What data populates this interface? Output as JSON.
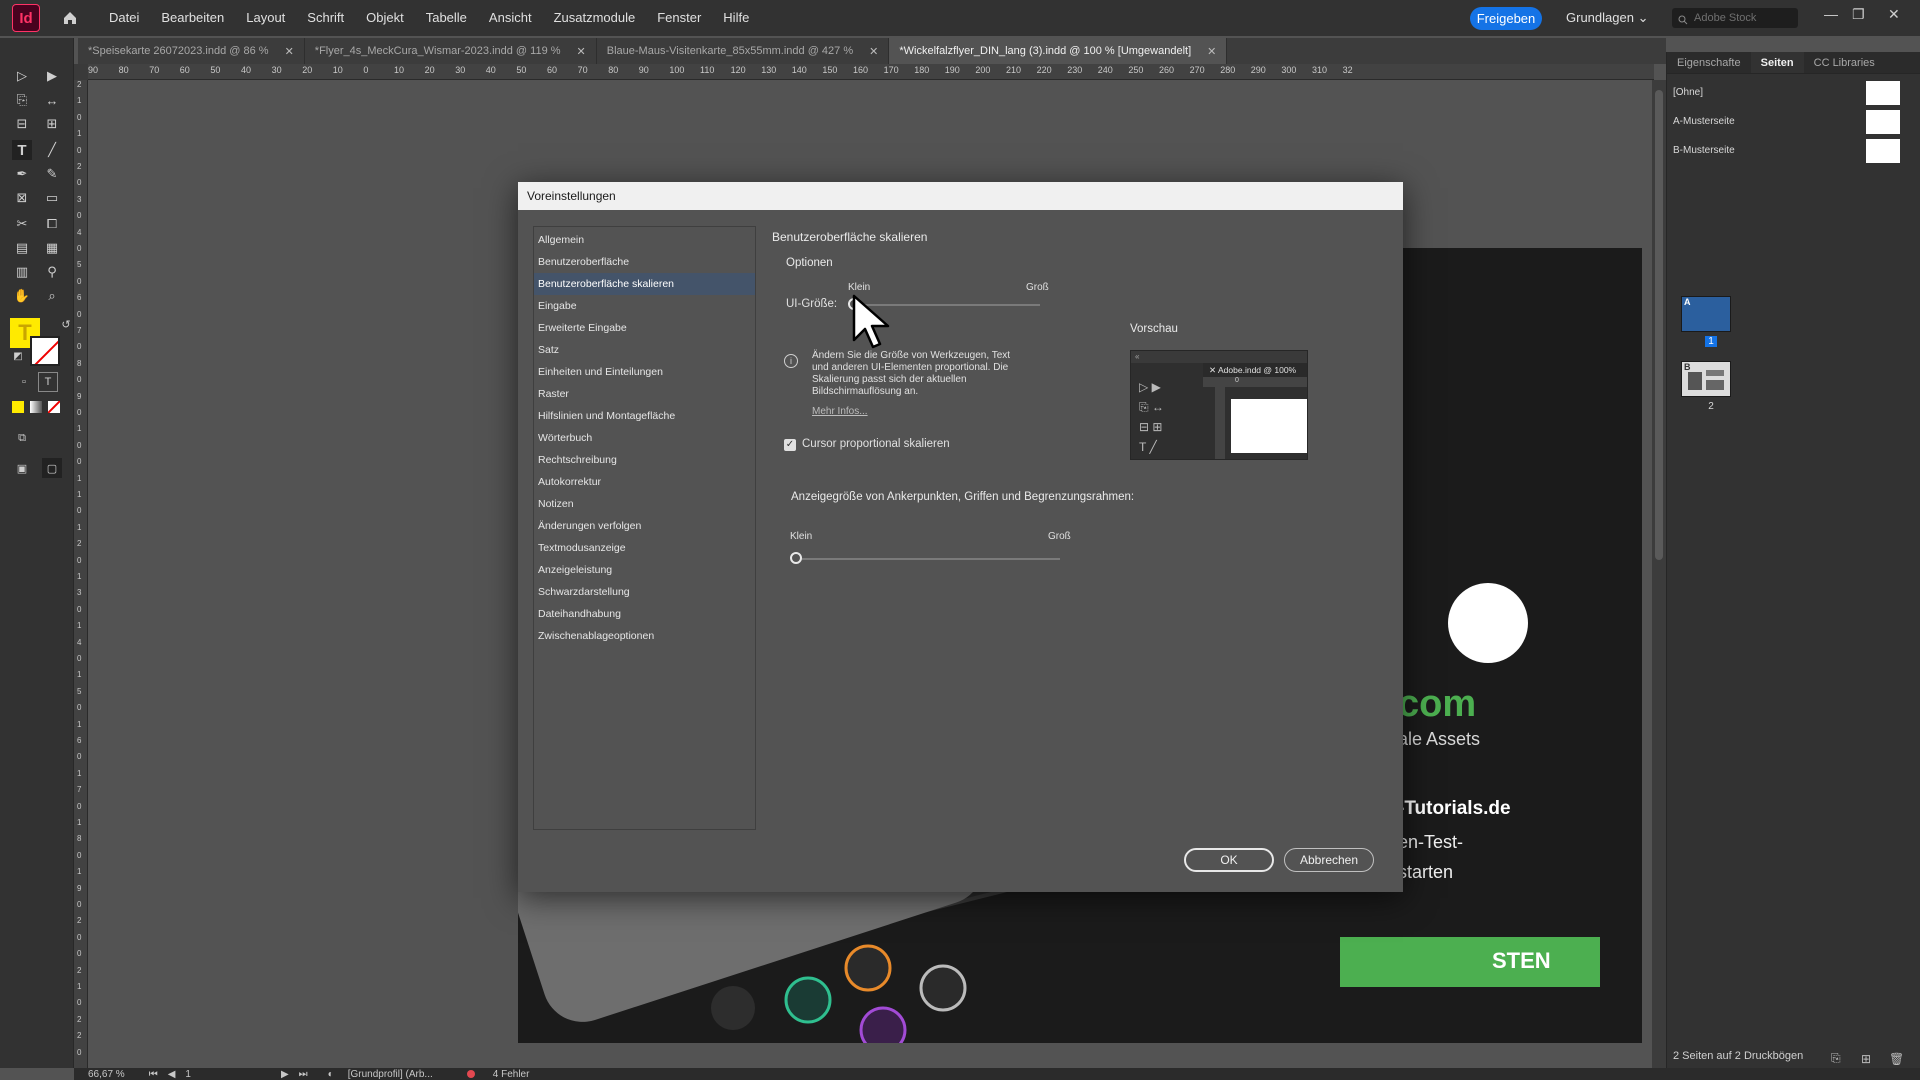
{
  "menubar": {
    "logo": "Id",
    "items": [
      "Datei",
      "Bearbeiten",
      "Layout",
      "Schrift",
      "Objekt",
      "Tabelle",
      "Ansicht",
      "Zusatzmodule",
      "Fenster",
      "Hilfe"
    ],
    "share": "Freigeben",
    "workspace": "Grundlagen",
    "search_placeholder": "Adobe Stock"
  },
  "tabs": [
    "*Speisekarte 26072023.indd @ 86 %",
    "*Flyer_4s_MeckCura_Wismar-2023.indd @ 119 %",
    "Blaue-Maus-Visitenkarte_85x55mm.indd @ 427 %",
    "*Wickelfalzflyer_DIN_lang (3).indd @ 100 % [Umgewandelt]"
  ],
  "ruler": {
    "h": [
      "90",
      "80",
      "70",
      "60",
      "50",
      "40",
      "30",
      "20",
      "10",
      "0",
      "10",
      "20",
      "30",
      "40",
      "50",
      "60",
      "70",
      "80",
      "90",
      "100",
      "110",
      "120",
      "130",
      "140",
      "150",
      "160",
      "170",
      "180",
      "190",
      "200",
      "210",
      "220",
      "230",
      "240",
      "250",
      "260",
      "270",
      "280",
      "290",
      "300",
      "310",
      "32"
    ],
    "v": [
      "2",
      "1",
      "0",
      "1",
      "0",
      "2",
      "0",
      "3",
      "0",
      "4",
      "0",
      "5",
      "0",
      "6",
      "0",
      "7",
      "0",
      "8",
      "0",
      "9",
      "0",
      "1",
      "0",
      "0",
      "1",
      "1",
      "0",
      "1",
      "2",
      "0",
      "1",
      "3",
      "0",
      "1",
      "4",
      "0",
      "1",
      "5",
      "0",
      "1",
      "6",
      "0",
      "1",
      "7",
      "0",
      "1",
      "8",
      "0",
      "1",
      "9",
      "0",
      "2",
      "0",
      "0",
      "2",
      "1",
      "0",
      "2",
      "2",
      "0"
    ]
  },
  "page_content": {
    "text_com": "com",
    "text_assets": "ale Assets",
    "text_tutorials": "-Tutorials.de",
    "text_test": "en-Test-",
    "text_starten": "starten",
    "cta": "STEN"
  },
  "right_panel": {
    "tabs": [
      "Eigenschafte",
      "Seiten",
      "CC Libraries"
    ],
    "masters": [
      "[Ohne]",
      "A-Musterseite",
      "B-Musterseite"
    ],
    "pages": [
      "1",
      "2"
    ],
    "thumb_letters": [
      "A",
      "B"
    ],
    "status": "2 Seiten auf 2 Druckbögen"
  },
  "statusbar": {
    "zoom": "66,67 %",
    "page": "1",
    "profile": "[Grundprofil] (Arb...",
    "errors": "4 Fehler"
  },
  "dialog": {
    "title": "Voreinstellungen",
    "categories": [
      "Allgemein",
      "Benutzeroberfläche",
      "Benutzeroberfläche skalieren",
      "Eingabe",
      "Erweiterte Eingabe",
      "Satz",
      "Einheiten und Einteilungen",
      "Raster",
      "Hilfslinien und Montagefläche",
      "Wörterbuch",
      "Rechtschreibung",
      "Autokorrektur",
      "Notizen",
      "Änderungen verfolgen",
      "Textmodusanzeige",
      "Anzeigeleistung",
      "Schwarzdarstellung",
      "Dateihandhabung",
      "Zwischenablageoptionen"
    ],
    "selected_index": 2,
    "heading": "Benutzeroberfläche skalieren",
    "options_label": "Optionen",
    "ui_size_label": "UI-Größe:",
    "small_label": "Klein",
    "large_label": "Groß",
    "ui_size_value": 0,
    "info_text": "Ändern Sie die Größe von Werkzeugen, Text und anderen UI-Elementen proportional. Die Skalierung passt sich der aktuellen Bildschirmauflösung an.",
    "more_info": "Mehr Infos...",
    "cursor_checkbox_label": "Cursor proportional skalieren",
    "cursor_checked": true,
    "preview_label": "Vorschau",
    "preview_doc": "Adobe.indd @ 100%",
    "preview_zero": "0",
    "anchor_label": "Anzeigegröße von Ankerpunkten, Griffen und Begrenzungsrahmen:",
    "anchor_value": 0,
    "ok": "OK",
    "cancel": "Abbrechen"
  },
  "colors": {
    "accent": "#1473e6",
    "selection": "#44546a",
    "indesign": "#ff3366",
    "green": "#4caf50"
  }
}
